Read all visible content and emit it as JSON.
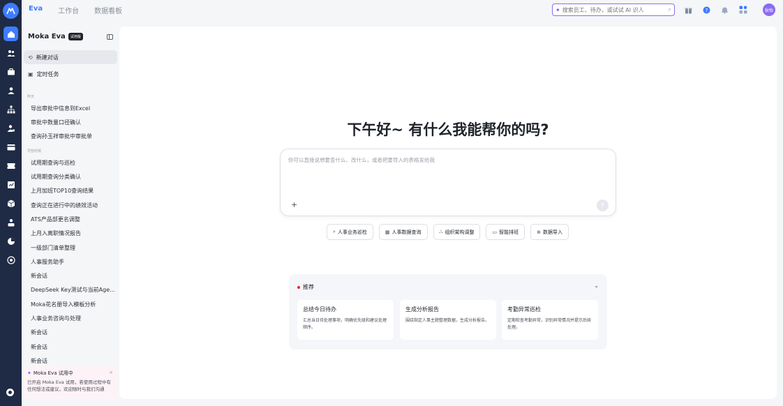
{
  "topbar": {
    "nav": [
      "Eva",
      "工作台",
      "数据看板"
    ],
    "active_tab": "Eva",
    "search_placeholder": "搜索员工、待办，或试试 AI 识人",
    "avatar_text": "秋怡"
  },
  "sidebar": {
    "title": "Moka Eva",
    "badge": "试用版",
    "new_chat": "新建对话",
    "scheduled": "定时任务",
    "section_yesterday": "昨天",
    "yesterday_items": [
      "导出审批中信息到Excel",
      "审批中数量口径确认",
      "查询孙玉祥审批中审批单"
    ],
    "section_earlier": "早些时候",
    "earlier_items": [
      "试用期查询与巡检",
      "试用期查询分类确认",
      "上月加班TOP10查询结果",
      "查询正在进行中的绩效活动",
      "ATS产品部更名调整",
      "上月入离职情况报告",
      "一级部门清单整理",
      "人事服务助手",
      "新会话",
      "DeepSeek Key测试与当前Age…",
      "Moka花名册导入模板分析",
      "人事业务咨询与处理",
      "新会话",
      "新会话",
      "新会话"
    ]
  },
  "trial": {
    "title": "Moka Eva 试用中",
    "text": "已开启 Moka Eva 试用，若使用过程中有任何想法或建议，欢迎随时与我们沟通"
  },
  "main": {
    "greeting": "下午好~ 有什么我能帮你的吗?",
    "composer_placeholder": "你可以直接说想要查什么、改什么，或者把要导入的表格发给我",
    "chips": [
      "人事业务巡检",
      "人事数据查询",
      "组织架构调整",
      "智能排班",
      "数据导入"
    ],
    "recommend": {
      "heading": "推荐",
      "cards": [
        {
          "title": "总结今日待办",
          "desc": "汇总当日待处理事项，明确优先级和建议处理顺序。"
        },
        {
          "title": "生成分析报告",
          "desc": "围绕指定人事主题整理数据，生成分析报告。"
        },
        {
          "title": "考勤异常巡检",
          "desc": "定期检查考勤异常，识别异常情况并提示后续处理。"
        }
      ]
    }
  },
  "colors": {
    "accent": "#3d7cff",
    "rail": "#1f2a44",
    "ai_purple": "#6b4cf5"
  }
}
